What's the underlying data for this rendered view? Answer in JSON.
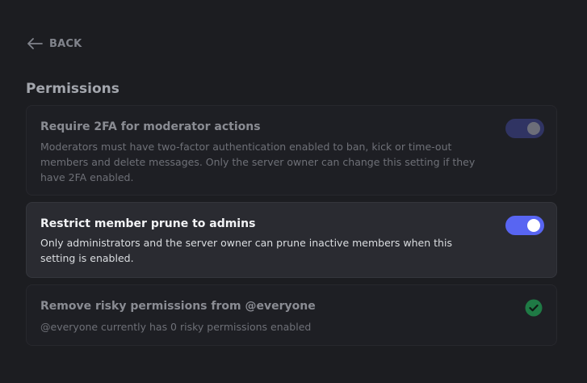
{
  "header": {
    "back_label": "BACK"
  },
  "section": {
    "title": "Permissions"
  },
  "settings": [
    {
      "title": "Require 2FA for moderator actions",
      "description": "Moderators must have two-factor authentication enabled to ban, kick or time-out members and delete messages. Only the server owner can change this setting if they have 2FA enabled.",
      "control": "toggle",
      "enabled": true,
      "disabled": true
    },
    {
      "title": "Restrict member prune to admins",
      "description": "Only administrators and the server owner can prune inactive members when this setting is enabled.",
      "control": "toggle",
      "enabled": true,
      "disabled": false
    },
    {
      "title": "Remove risky permissions from @everyone",
      "description": "@everyone currently has 0 risky permissions enabled",
      "control": "check-icon",
      "status": "complete"
    }
  ],
  "colors": {
    "accent": "#5865f2",
    "toggle_disabled": "#303463",
    "success": "#23a55a"
  }
}
